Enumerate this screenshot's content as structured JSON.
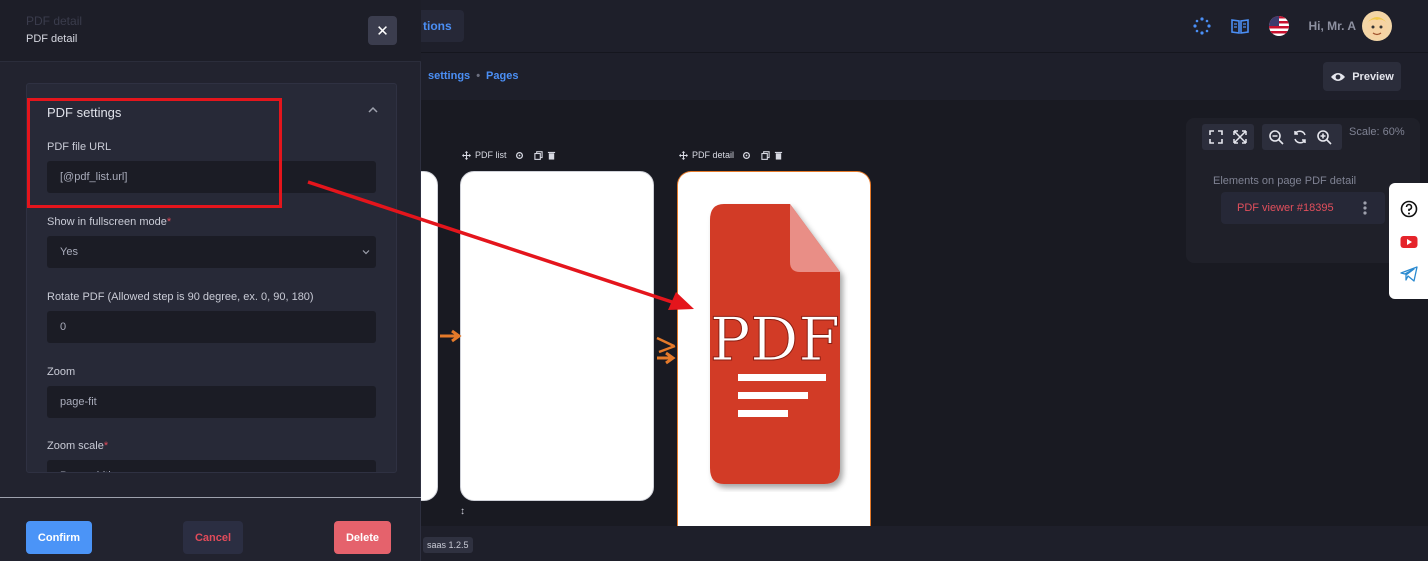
{
  "topbar": {
    "tab_label": "tions",
    "greeting": "Hi, Mr. A"
  },
  "subbar": {
    "crumb_1": "settings",
    "crumb_sep": "•",
    "crumb_2": "Pages",
    "preview_label": "Preview"
  },
  "canvas": {
    "page_list_label": "PDF list",
    "page_detail_label": "PDF detail",
    "resize_glyph": "↕",
    "pdf_glyph_text": "PDF"
  },
  "zoom_panel": {
    "scale_label": "Scale: 60%",
    "elements_label": "Elements on page PDF detail",
    "element_chip": "PDF viewer #18395"
  },
  "footer": {
    "version": "saas 1.2.5"
  },
  "modal": {
    "ghost_title": "PDF detail",
    "title": "PDF detail",
    "close_glyph": "✕",
    "section_title": "PDF settings",
    "fields": {
      "file_url_label": "PDF file URL",
      "file_url_value": "[@pdf_list.url]",
      "fullscreen_label": "Show in fullscreen mode",
      "fullscreen_value": "Yes",
      "rotate_label": "Rotate PDF (Allowed step is 90 degree, ex. 0, 90, 180)",
      "rotate_value": "0",
      "zoom_label": "Zoom",
      "zoom_value": "page-fit",
      "zoom_scale_label": "Zoom scale",
      "zoom_scale_value": "Page width",
      "required_mark": "*"
    },
    "buttons": {
      "confirm": "Confirm",
      "cancel": "Cancel",
      "delete": "Delete"
    }
  },
  "colors": {
    "accent_blue": "#4b94f7",
    "danger": "#e5626c",
    "annotation_red": "#e4151c",
    "pdf_red": "#d23a26",
    "flow_orange": "#e57a2a"
  }
}
